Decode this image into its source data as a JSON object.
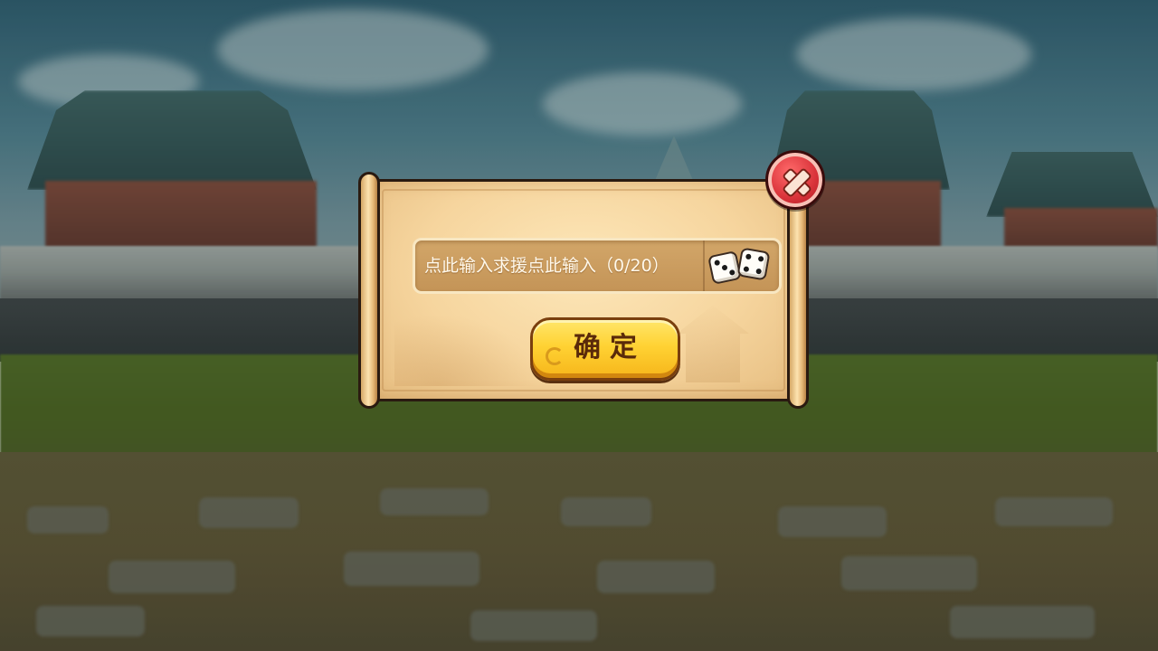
{
  "dialog": {
    "input_text": "点此输入求援点此输入（0/20）",
    "confirm_label": "确定"
  },
  "icons": {
    "close": "close-icon",
    "random": "dice-icon"
  },
  "colors": {
    "scroll": "#f6d59e",
    "button": "#ffd233",
    "close": "#d9333a"
  }
}
